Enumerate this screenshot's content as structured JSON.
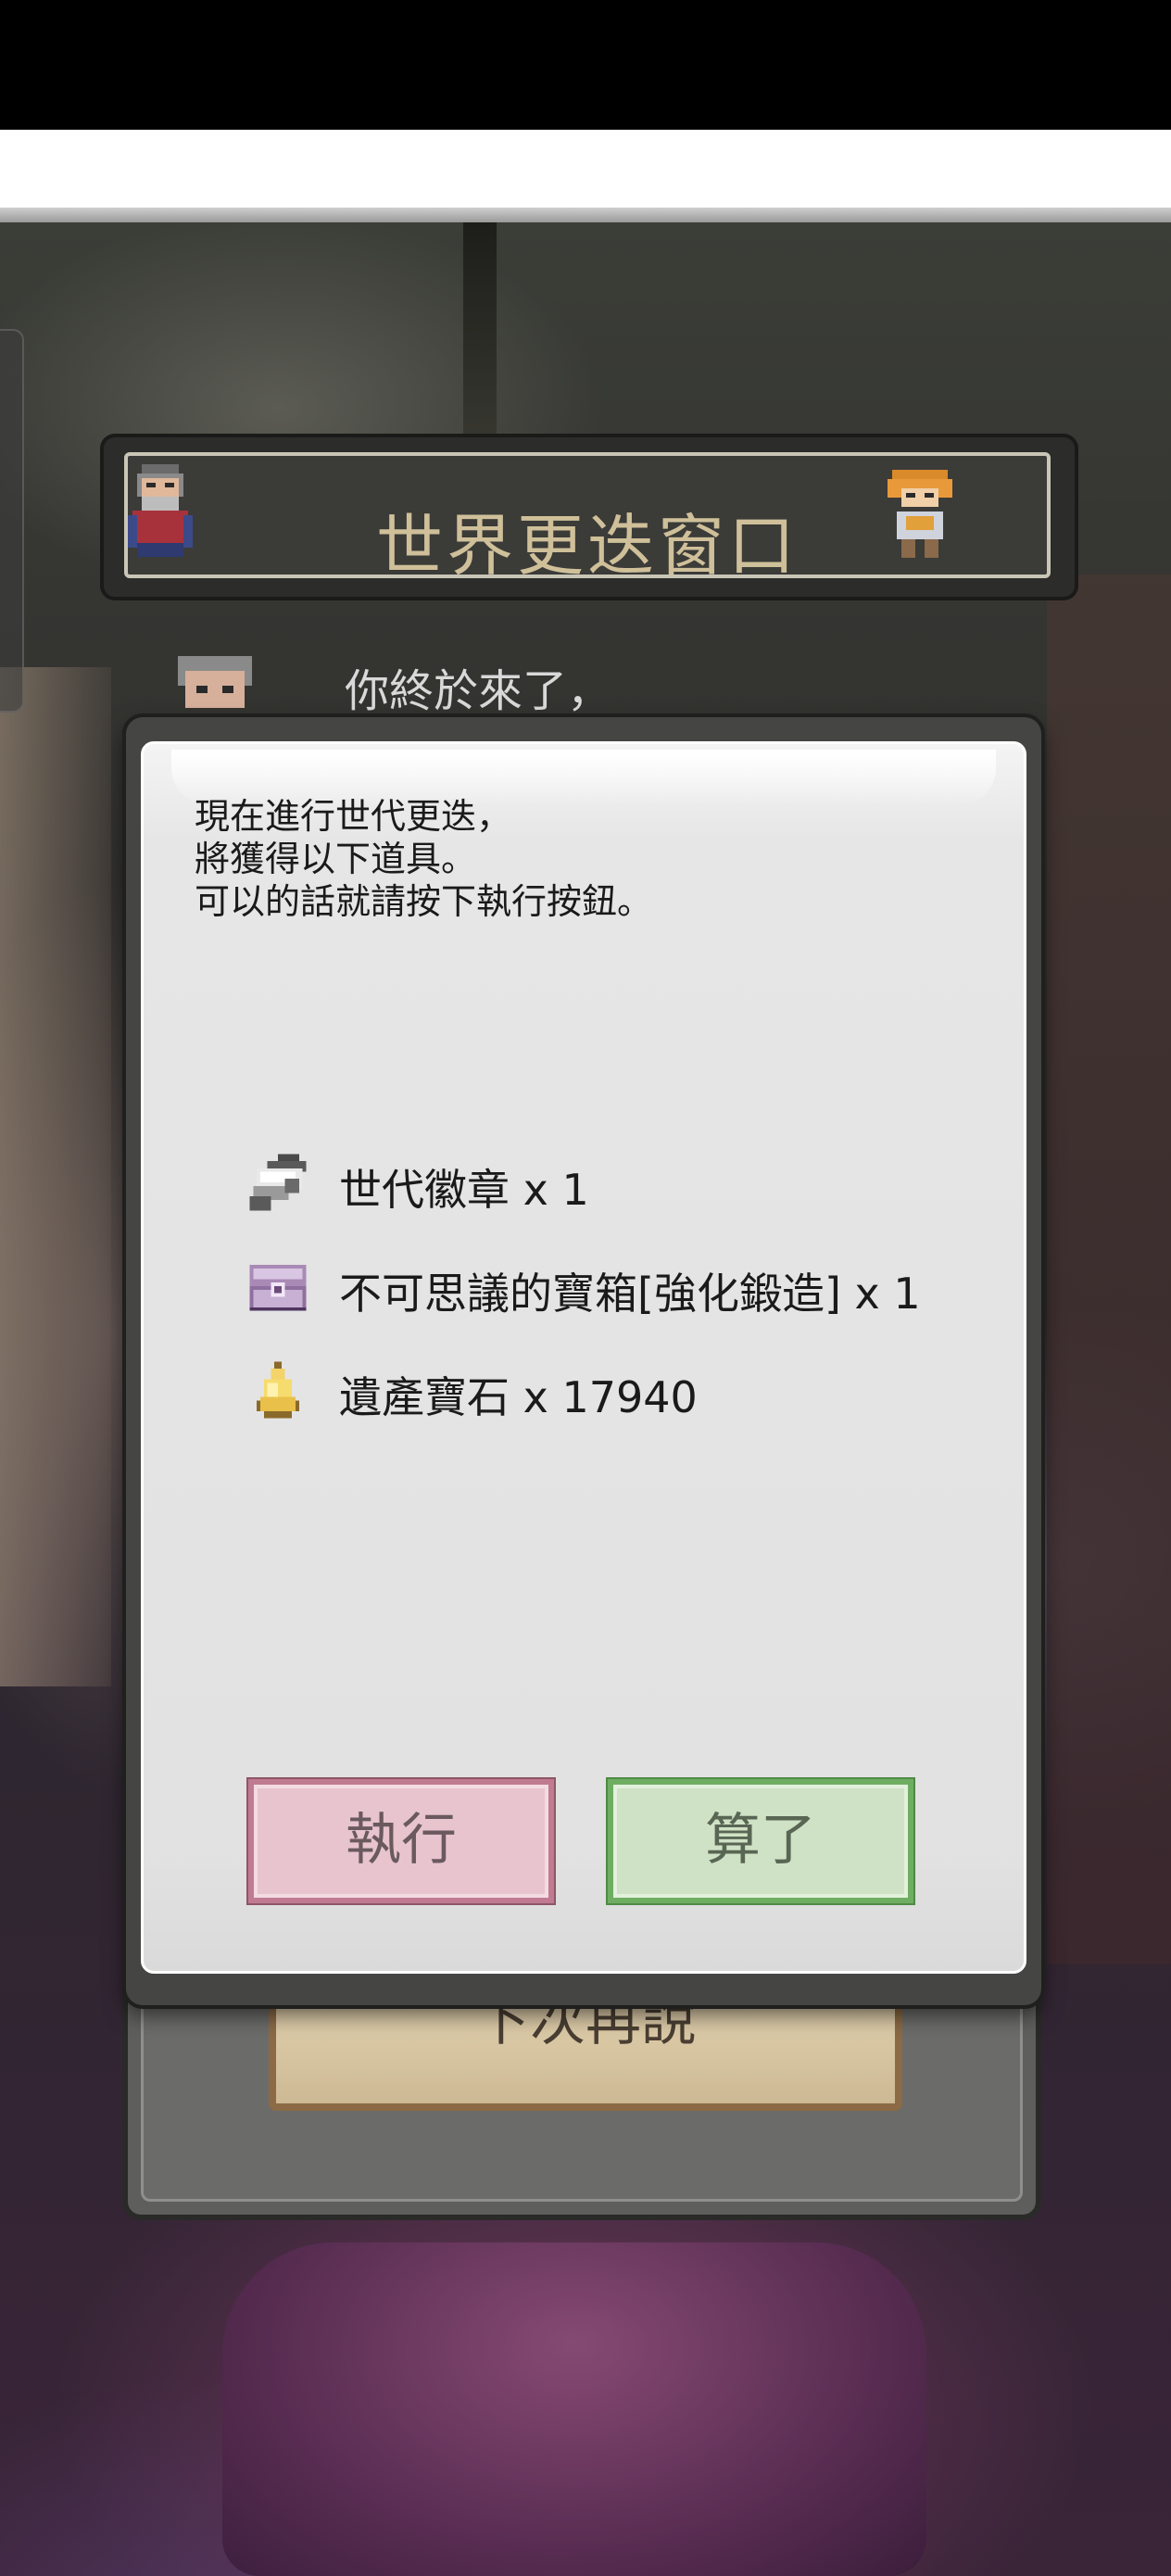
{
  "window": {
    "title": "世界更迭窗口"
  },
  "dialogue": {
    "line": "你終於來了，"
  },
  "dialog": {
    "message_lines": [
      "現在進行世代更迭，",
      "將獲得以下道具。",
      "可以的話就請按下執行按鈕。"
    ],
    "items": [
      {
        "icon": "badge-icon",
        "label": "世代徽章 x 1"
      },
      {
        "icon": "treasure-chest-icon",
        "label": "不可思議的寶箱[強化鍛造] x 1"
      },
      {
        "icon": "gem-icon",
        "label": "遺產寶石 x 17940"
      }
    ],
    "execute_label": "執行",
    "cancel_label": "算了"
  },
  "background_panel": {
    "later_label": "下次再說"
  },
  "colors": {
    "execute_button": "#e8c4cf",
    "cancel_button": "#cfe2c5",
    "title_text": "#cfc09a"
  }
}
